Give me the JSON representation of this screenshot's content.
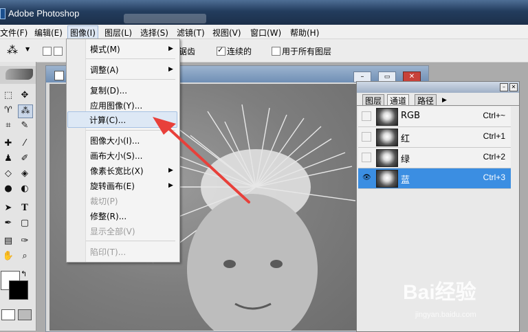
{
  "app": {
    "title": "Adobe Photoshop"
  },
  "menubar": [
    {
      "label": "文件(F)"
    },
    {
      "label": "编辑(E)"
    },
    {
      "label": "图像(I)"
    },
    {
      "label": "图层(L)"
    },
    {
      "label": "选择(S)"
    },
    {
      "label": "滤镜(T)"
    },
    {
      "label": "视图(V)"
    },
    {
      "label": "窗口(W)"
    },
    {
      "label": "帮助(H)"
    }
  ],
  "options": {
    "antialias_tail": "锯齿",
    "contiguous": "连续的",
    "contiguous_checked": true,
    "all_layers": "用于所有图层",
    "all_layers_checked": false
  },
  "image_menu": {
    "items": [
      {
        "label": "模式(M)",
        "submenu": true,
        "disabled": false
      },
      {
        "label": "调整(A)",
        "submenu": true,
        "disabled": false
      },
      {
        "label": "复制(D)...",
        "submenu": false,
        "disabled": false
      },
      {
        "label": "应用图像(Y)...",
        "submenu": false,
        "disabled": false
      },
      {
        "label": "计算(C)...",
        "submenu": false,
        "disabled": false,
        "highlighted": true
      },
      {
        "label": "图像大小(I)...",
        "submenu": false,
        "disabled": false
      },
      {
        "label": "画布大小(S)...",
        "submenu": false,
        "disabled": false
      },
      {
        "label": "像素长宽比(X)",
        "submenu": true,
        "disabled": false
      },
      {
        "label": "旋转画布(E)",
        "submenu": true,
        "disabled": false
      },
      {
        "label": "裁切(P)",
        "submenu": false,
        "disabled": true
      },
      {
        "label": "修整(R)...",
        "submenu": false,
        "disabled": false
      },
      {
        "label": "显示全部(V)",
        "submenu": false,
        "disabled": true
      },
      {
        "label": "陷印(T)...",
        "submenu": false,
        "disabled": true
      }
    ]
  },
  "panel": {
    "tabs": [
      {
        "label": "图层"
      },
      {
        "label": "通道"
      },
      {
        "label": "路径"
      }
    ],
    "active_tab": "通道",
    "channels": [
      {
        "name": "RGB",
        "shortcut": "Ctrl+~",
        "visible": false,
        "selected": false
      },
      {
        "name": "红",
        "shortcut": "Ctrl+1",
        "visible": false,
        "selected": false
      },
      {
        "name": "绿",
        "shortcut": "Ctrl+2",
        "visible": false,
        "selected": false
      },
      {
        "name": "蓝",
        "shortcut": "Ctrl+3",
        "visible": true,
        "selected": true
      }
    ]
  },
  "watermark": {
    "brand": "Bai经验",
    "url": "jingyan.baidu.com"
  },
  "colors": {
    "highlight": "#3b8ee2",
    "menu_hover": "#dde8f5",
    "arrow": "#e8403a"
  }
}
